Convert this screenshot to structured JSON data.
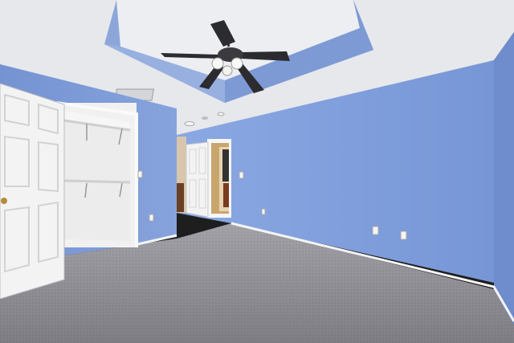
{
  "image": {
    "kind": "photograph",
    "subject": "empty-bedroom-interior",
    "elements": [
      "tray-ceiling",
      "ceiling-fan",
      "walk-in-closet",
      "interior-door",
      "hallway-door",
      "carpet-floor",
      "outlets",
      "ceiling-vent"
    ]
  },
  "colors": {
    "wall": "#7f9fdc",
    "wall_shadow": "#6a88c8",
    "ceiling": "#e9ebef",
    "tray": "#8aa4d9",
    "carpet": "#8a8a90",
    "trim": "#f4f4f4",
    "door": "#f3f3f3",
    "fan_blade": "#2b2b30"
  }
}
